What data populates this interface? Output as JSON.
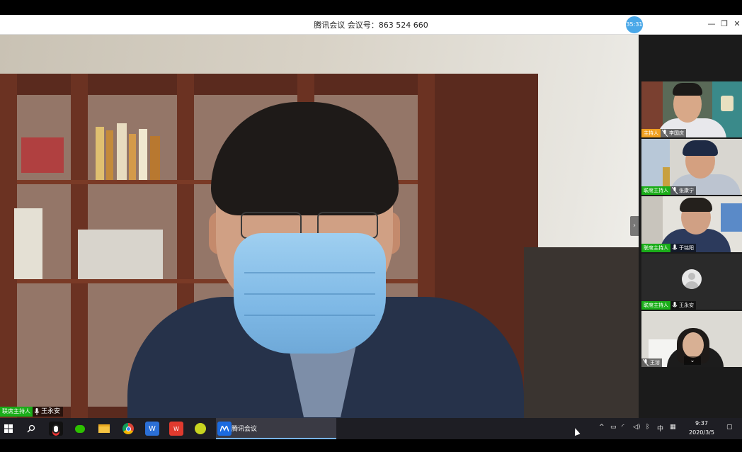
{
  "window": {
    "title": "腾讯会议 会议号：863 524 660",
    "timer": "35:31",
    "controls": [
      "—",
      "❐",
      "✕"
    ]
  },
  "main_video": {
    "role_tag": "联席主持人",
    "name": "王永安"
  },
  "participants": [
    {
      "role_tag": "主持人",
      "role_color": "#f0a020",
      "name": "李国庆"
    },
    {
      "role_tag": "联席主持人",
      "role_color": "#1aad19",
      "name": "张康宁"
    },
    {
      "role_tag": "联席主持人",
      "role_color": "#1aad19",
      "name": "于铭阳"
    },
    {
      "role_tag": "联席主持人",
      "role_color": "#1aad19",
      "name": "王永安"
    },
    {
      "role_tag": "",
      "role_color": "",
      "name": "王溶"
    }
  ],
  "taskbar": {
    "active_app": "腾讯会议",
    "icons": [
      "windows-start-icon",
      "search-icon",
      "qq-icon",
      "wechat-icon",
      "file-explorer-icon",
      "chrome-icon",
      "wps-writer-icon",
      "wps-icon",
      "media-player-icon",
      "tencent-meeting-icon"
    ],
    "tray_lang": "中",
    "time": "9:37",
    "date": "2020/3/5"
  }
}
